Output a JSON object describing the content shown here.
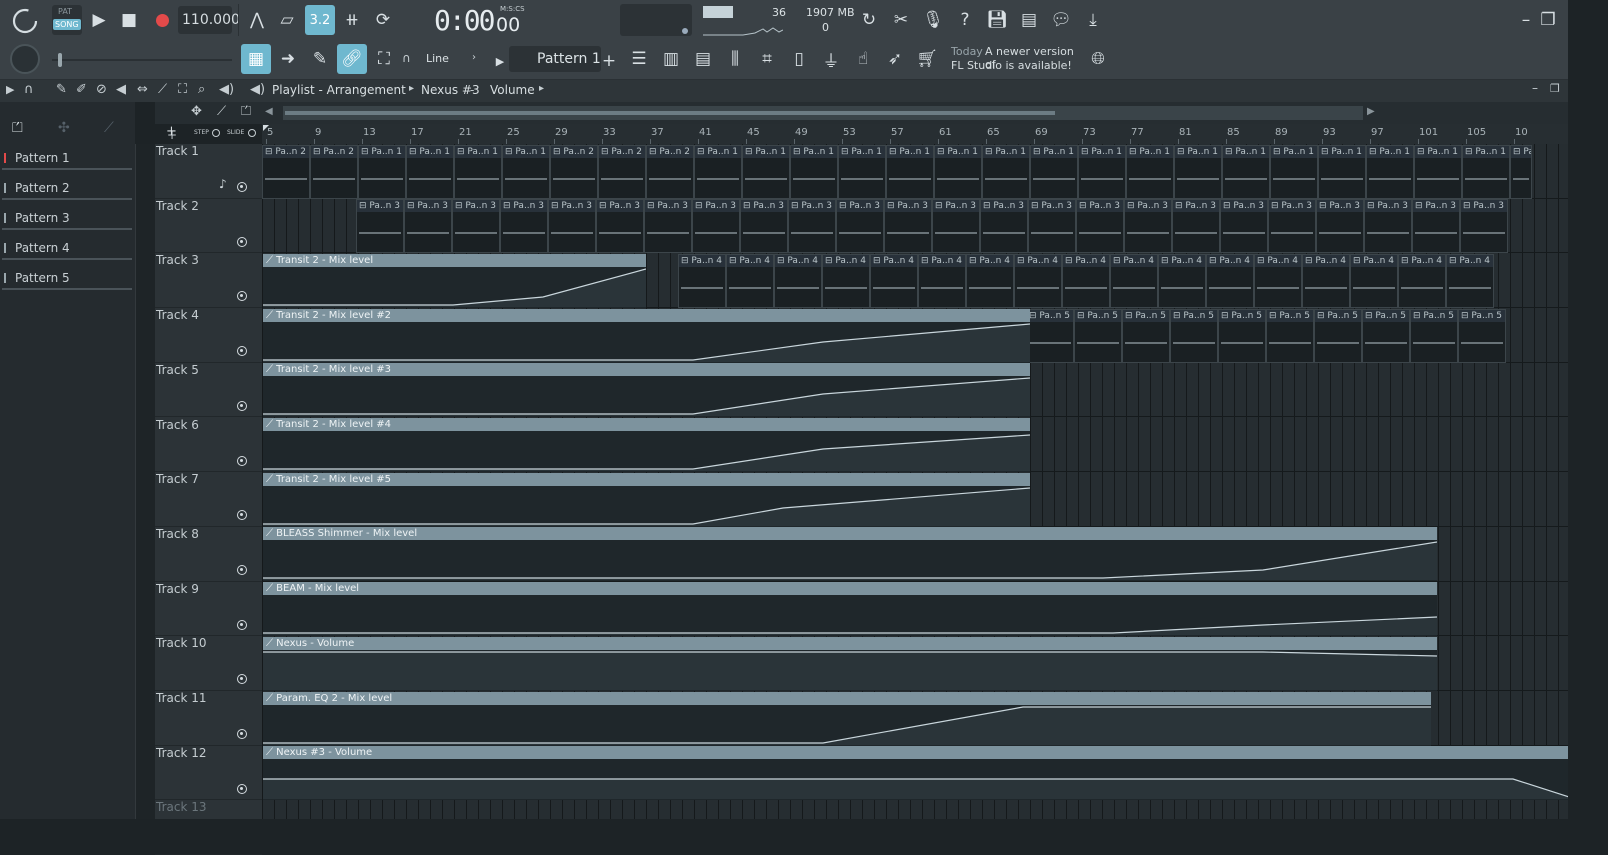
{
  "transport": {
    "pat_label": "PAT",
    "song_label": "SONG",
    "tempo": "110.000",
    "time": "0:00",
    "time_cs": "00",
    "time_format": "M:S:CS",
    "snap_value": "3.2",
    "cpu_value": "36",
    "memory": "1907 MB",
    "polyphony": "0"
  },
  "toolbar2": {
    "tool_mode": "Line",
    "pattern_selector": "Pattern 1",
    "news_today": "Today",
    "news_text_1": "A newer version of",
    "news_text_2": "FL Studio is available!"
  },
  "playlist": {
    "title": "Playlist - Arrangement",
    "breadcrumb_1": "Nexus #3",
    "breadcrumb_2": "Volume",
    "step_label": "STEP",
    "slide_label": "SLIDE"
  },
  "patterns": [
    "Pattern 1",
    "Pattern 2",
    "Pattern 3",
    "Pattern 4",
    "Pattern 5"
  ],
  "ruler": [
    "5",
    "9",
    "13",
    "17",
    "21",
    "25",
    "29",
    "33",
    "37",
    "41",
    "45",
    "49",
    "53",
    "57",
    "61",
    "65",
    "69",
    "73",
    "77",
    "81",
    "85",
    "89",
    "93",
    "97",
    "101",
    "105",
    "10"
  ],
  "tracks": [
    "Track 1",
    "Track 2",
    "Track 3",
    "Track 4",
    "Track 5",
    "Track 6",
    "Track 7",
    "Track 8",
    "Track 9",
    "Track 10",
    "Track 11",
    "Track 12",
    "Track 13"
  ],
  "clip_labels": {
    "p1": "Pa..n 1",
    "p2": "Pa..n 2",
    "p3": "Pa..n 3",
    "p4": "Pa..n 4",
    "p5": "Pa..n 5",
    "pfull": "Pattern 1"
  },
  "automation": [
    {
      "track": "Track 3",
      "label": "Transit 2 - Mix level"
    },
    {
      "track": "Track 4",
      "label": "Transit 2 - Mix level #2"
    },
    {
      "track": "Track 5",
      "label": "Transit 2 - Mix level #3"
    },
    {
      "track": "Track 6",
      "label": "Transit 2 - Mix level #4"
    },
    {
      "track": "Track 7",
      "label": "Transit 2 - Mix level #5"
    },
    {
      "track": "Track 8",
      "label": "BLEASS Shimmer - Mix level"
    },
    {
      "track": "Track 9",
      "label": "BEAM - Mix level"
    },
    {
      "track": "Track 10",
      "label": "Nexus - Volume"
    },
    {
      "track": "Track 11",
      "label": "Param. EQ 2 - Mix level"
    },
    {
      "track": "Track 12",
      "label": "Nexus #3 - Volume"
    }
  ],
  "colors": {
    "accent": "#6fb8cf",
    "automation_clip": "#7d939e",
    "record": "#e34a4a"
  }
}
